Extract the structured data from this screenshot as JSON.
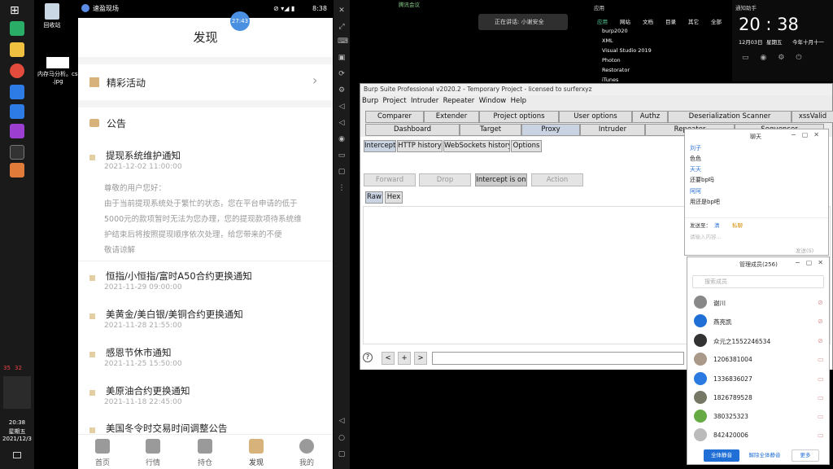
{
  "taskbar": {
    "badges": [
      "35",
      "32"
    ],
    "time": "20:38",
    "weekday": "星期五",
    "date": "2021/12/3"
  },
  "desktop": {
    "recycle_label": "回收站",
    "file_label_1": "内存马分析。cs20",
    "file_label_2": ".jpg"
  },
  "phone": {
    "status_bubble": "27:43",
    "status_time": "8:38",
    "title": "发现",
    "activity_label": "精彩活动",
    "announcement_label": "公告",
    "notices": [
      {
        "title": "提现系统维护通知",
        "date": "2021-12-02 11:00:00"
      },
      {
        "title": "恒指/小恒指/富时A50合约更换通知",
        "date": "2021-11-29 09:00:00"
      },
      {
        "title": "美黄金/美白银/美铜合约更换通知",
        "date": "2021-11-28 21:55:00"
      },
      {
        "title": "感恩节休市通知",
        "date": "2021-11-25 15:50:00"
      },
      {
        "title": "美原油合约更换通知",
        "date": "2021-11-18 22:45:00"
      },
      {
        "title": "美国冬令时交易时间调整公告",
        "date": ""
      }
    ],
    "notice_body": [
      "尊敬的用户您好：",
      "由于当前提现系统处于繁忙的状态，您在平台申请的低于",
      "5000元的款项暂时无法为您办理，您的提现款项待系统维",
      "护结束后将按照提现顺序依次处理，给您带来的不便",
      "敬请谅解"
    ],
    "nav": [
      "首页",
      "行情",
      "持仓",
      "发现",
      "我的"
    ]
  },
  "top": {
    "meeting_label": "腾讯会议",
    "speaking_label": "正在讲话: 小谢安全",
    "right_panel_title": "通知助手",
    "big_time": "20 : 38",
    "small_date": "12月03日",
    "small_weekday": "星期五",
    "small_extra": "今年十月十一"
  },
  "apps": {
    "tabs": [
      "应用",
      "网站",
      "文档",
      "目录",
      "其它",
      "全部"
    ],
    "list": [
      "burp2020",
      "XML",
      "Visual Studio 2019",
      "Photon",
      "Restorator",
      "iTunes"
    ]
  },
  "burp": {
    "title": "Burp Suite Professional v2020.2 - Temporary Project - licensed to surferxyz",
    "menu": [
      "Burp",
      "Project",
      "Intruder",
      "Repeater",
      "Window",
      "Help"
    ],
    "tabs_row1": [
      "Comparer",
      "Extender",
      "Project options",
      "User options",
      "Authz",
      "Deserialization Scanner",
      "xssValid"
    ],
    "tabs_row2": [
      "Dashboard",
      "Target",
      "Proxy",
      "Intruder",
      "Repeater",
      "Sequencer"
    ],
    "subtabs": [
      "Intercept",
      "HTTP history",
      "WebSockets history",
      "Options"
    ],
    "buttons": [
      "Forward",
      "Drop",
      "Intercept is on",
      "Action"
    ],
    "view_tabs": [
      "Raw",
      "Hex"
    ],
    "bottom": [
      "?",
      "<",
      "+",
      ">"
    ]
  },
  "chat": {
    "title": "聊天",
    "messages": [
      "刘子",
      "色色",
      "天天",
      "还要bp吗",
      "阿阿",
      "用还是bp吧"
    ],
    "input_label": "发送至：",
    "input_opt1": "清",
    "input_opt2": "私聊",
    "input_placeholder": "请输入内容...",
    "send_label": "发送(S)"
  },
  "members": {
    "title": "管理成员(256)",
    "search_placeholder": "搜索成员",
    "list": [
      "谢川",
      "燕亮凯",
      "众元之1552246534",
      "1206381004",
      "1336836027",
      "1826789528",
      "380325323",
      "842420006"
    ],
    "footer_primary": "全体静音",
    "footer_secondary": "解除全体静音",
    "footer_more": "更多"
  }
}
